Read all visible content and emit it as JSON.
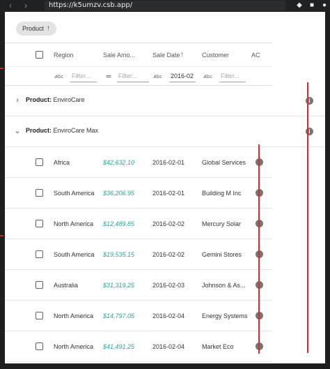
{
  "browser": {
    "url": "https://k5umzv.csb.app/",
    "back_icon": "chevron-left-icon",
    "forward_icon": "chevron-right-icon",
    "reload_icon": "refresh-icon"
  },
  "group_panel": {
    "chip_label": "Product",
    "chip_icon": "arrow-up-icon"
  },
  "columns": [
    {
      "label": "Region"
    },
    {
      "label": "Sale Amo..."
    },
    {
      "label": "Sale Date",
      "sort_icon": "arrow-up-icon"
    },
    {
      "label": "Customer"
    },
    {
      "label": "AC"
    }
  ],
  "filters": [
    {
      "operator_icon": "abc-icon",
      "placeholder": "Filter...",
      "value": ""
    },
    {
      "operator_icon": "equals-icon",
      "placeholder": "Filter...",
      "value": ""
    },
    {
      "operator_icon": "abc-icon",
      "placeholder": "Filter...",
      "value": "2016-02"
    },
    {
      "operator_icon": "abc-icon",
      "placeholder": "Filter...",
      "value": ""
    }
  ],
  "groups": [
    {
      "field": "Product:",
      "value": "EnviroCare",
      "expanded": false
    },
    {
      "field": "Product:",
      "value": "EnviroCare Max",
      "expanded": true
    }
  ],
  "rows": [
    {
      "region": "Africa",
      "amount": "$42,632.10",
      "date": "2016-02-01",
      "customer": "Global Services"
    },
    {
      "region": "South America",
      "amount": "$36,206.95",
      "date": "2016-02-01",
      "customer": "Building M Inc"
    },
    {
      "region": "North America",
      "amount": "$12,489.85",
      "date": "2016-02-02",
      "customer": "Mercury Solar"
    },
    {
      "region": "South America",
      "amount": "$19,535.15",
      "date": "2016-02-02",
      "customer": "Gemini Stores"
    },
    {
      "region": "Australia",
      "amount": "$31,319.25",
      "date": "2016-02-03",
      "customer": "Johnson & As..."
    },
    {
      "region": "North America",
      "amount": "$14,797.05",
      "date": "2016-02-04",
      "customer": "Energy Systems"
    },
    {
      "region": "North America",
      "amount": "$41,491.25",
      "date": "2016-02-04",
      "customer": "Market Eco"
    }
  ],
  "colors": {
    "amount_text": "#26a69a",
    "annotation_line": "#d32f2f",
    "chip_bg": "#e3e3e3"
  }
}
